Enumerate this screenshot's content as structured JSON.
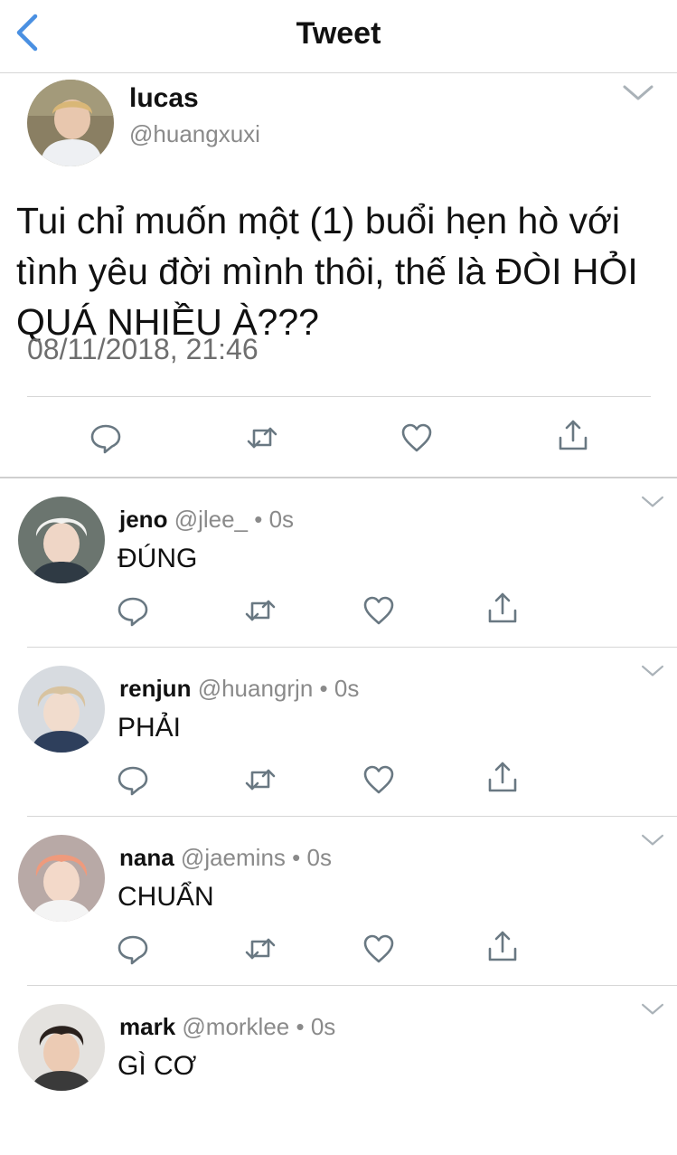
{
  "nav": {
    "title": "Tweet"
  },
  "tweet": {
    "name": "lucas",
    "handle": "@huangxuxi",
    "text": "Tui chỉ muốn một (1) buổi hẹn hò với tình yêu đời mình thôi, thế là ĐÒI HỎI QUÁ NHIỀU À???",
    "timestamp": "08/11/2018, 21:46"
  },
  "replies": [
    {
      "name": "jeno",
      "handle": "@jlee_",
      "dot": "•",
      "time": "0s",
      "text": "ĐÚNG"
    },
    {
      "name": "renjun",
      "handle": "@huangrjn",
      "dot": "•",
      "time": "0s",
      "text": "PHẢI"
    },
    {
      "name": "nana",
      "handle": "@jaemins",
      "dot": "•",
      "time": "0s",
      "text": "CHUẨN"
    },
    {
      "name": "mark",
      "handle": "@morklee",
      "dot": "•",
      "time": "0s",
      "text": "GÌ CƠ"
    }
  ],
  "icons": {
    "back": "chevron-left-icon",
    "more": "chevron-down-icon",
    "reply": "comment-icon",
    "retweet": "retweet-icon",
    "like": "heart-icon",
    "share": "share-icon"
  },
  "colors": {
    "accent": "#4a90e2",
    "text": "#111111",
    "muted": "#8a8a8a",
    "icon": "#697882"
  }
}
